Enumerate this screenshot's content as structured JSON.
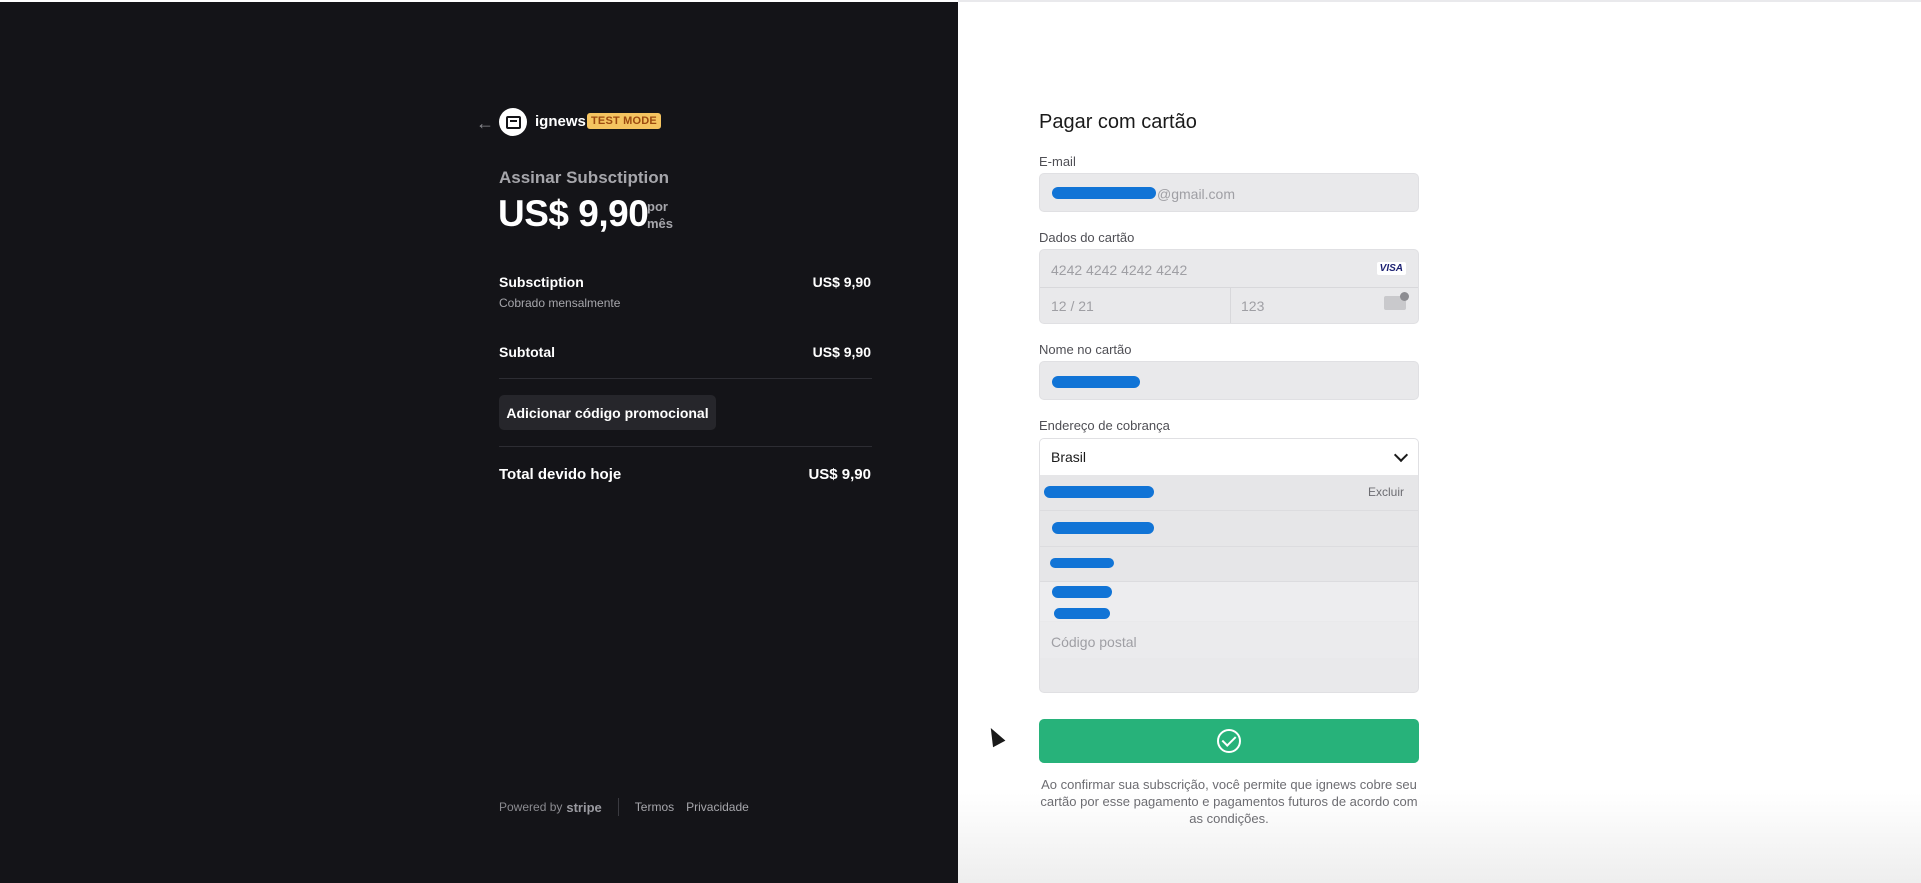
{
  "summary": {
    "back_icon": "arrow-left",
    "brand_name": "ignews",
    "test_badge": "TEST MODE",
    "subscribe_title": "Assinar Subsctiption",
    "price": "US$ 9,90",
    "per_label_1": "por",
    "per_label_2": "mês",
    "line_item": {
      "label": "Subsctiption",
      "note": "Cobrado mensalmente",
      "value": "US$ 9,90"
    },
    "subtotal": {
      "label": "Subtotal",
      "value": "US$ 9,90"
    },
    "promo_button": "Adicionar código promocional",
    "total": {
      "label": "Total devido hoje",
      "value": "US$ 9,90"
    }
  },
  "footer": {
    "powered_by": "Powered by",
    "stripe": "stripe",
    "terms": "Termos",
    "privacy": "Privacidade"
  },
  "form": {
    "title": "Pagar com cartão",
    "email_label": "E-mail",
    "email_suffix": "@gmail.com",
    "card_label": "Dados do cartão",
    "card_number_placeholder": "4242 4242 4242 4242",
    "card_brand": "VISA",
    "expiry_placeholder": "12 / 21",
    "cvc_placeholder": "123",
    "name_label": "Nome no cartão",
    "address_label": "Endereço de cobrança",
    "country_value": "Brasil",
    "delete_label": "Excluir",
    "postal_placeholder": "Código postal",
    "pay_icon": "check-circle",
    "terms_text": "Ao confirmar sua subscrição, você permite que ignews cobre seu cartão por esse pagamento e pagamentos futuros de acordo com as condições.",
    "accent_color": "#27b27a"
  }
}
